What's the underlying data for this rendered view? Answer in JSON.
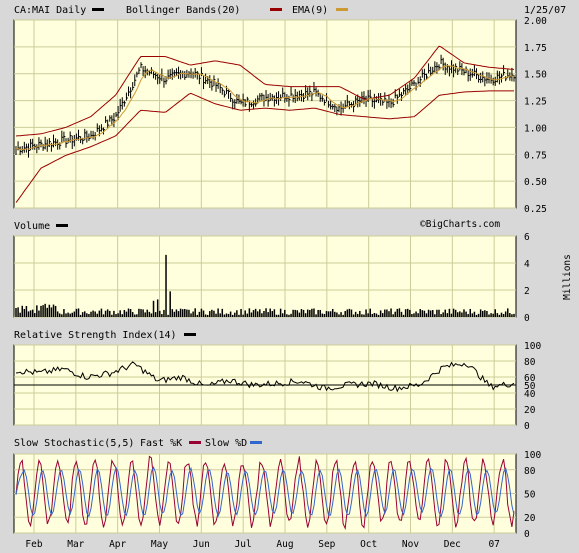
{
  "header": {
    "symbol": "CA:MAI Daily",
    "bollinger": "Bollinger Bands(20)",
    "ema": "EMA(9)",
    "date": "1/25/07"
  },
  "watermark": "©BigCharts.com",
  "colors": {
    "panel_bg": "#ffffdd",
    "grid": "#cccc99",
    "price": "#000000",
    "bollinger": "#990000",
    "ema": "#cc9933",
    "stoch_k": "#990033",
    "stoch_d": "#3366cc"
  },
  "chart_data": [
    {
      "type": "line",
      "name": "price",
      "ylim": [
        0.25,
        2.0
      ],
      "yticks": [
        "2.00",
        "1.75",
        "1.50",
        "1.25",
        "1.00",
        "0.75",
        "0.50",
        "0.25"
      ],
      "x_months": [
        "Feb",
        "Mar",
        "Apr",
        "May",
        "Jun",
        "Jul",
        "Aug",
        "Sep",
        "Oct",
        "Nov",
        "Dec",
        "07"
      ],
      "series": [
        {
          "name": "CA:MAI Daily",
          "values": [
            0.8,
            0.84,
            0.88,
            0.92,
            1.1,
            1.55,
            1.45,
            1.52,
            1.4,
            1.22,
            1.28,
            1.3,
            1.32,
            1.18,
            1.26,
            1.22,
            1.4,
            1.6,
            1.52,
            1.45,
            1.5
          ]
        },
        {
          "name": "Bollinger upper",
          "values": [
            0.92,
            0.94,
            1.0,
            1.1,
            1.3,
            1.66,
            1.66,
            1.58,
            1.62,
            1.58,
            1.4,
            1.38,
            1.38,
            1.38,
            1.26,
            1.3,
            1.46,
            1.76,
            1.6,
            1.56,
            1.54
          ]
        },
        {
          "name": "Bollinger lower",
          "values": [
            0.3,
            0.62,
            0.74,
            0.82,
            0.92,
            1.16,
            1.14,
            1.32,
            1.22,
            1.16,
            1.18,
            1.16,
            1.18,
            1.12,
            1.1,
            1.08,
            1.1,
            1.3,
            1.33,
            1.34,
            1.34
          ]
        }
      ]
    },
    {
      "type": "bar",
      "name": "Volume",
      "unit": "Millions",
      "ylim": [
        0,
        6
      ],
      "yticks": [
        "6",
        "4",
        "2",
        "0"
      ],
      "spikes": [
        4.6,
        1.9,
        1.2,
        1.3
      ]
    },
    {
      "type": "line",
      "name": "Relative Strength Index(14)",
      "ylim": [
        0,
        100
      ],
      "yticks": [
        "100",
        "80",
        "60",
        "50",
        "40",
        "20",
        "0"
      ],
      "reference": 50,
      "values": [
        68,
        65,
        70,
        60,
        65,
        76,
        55,
        60,
        48,
        56,
        50,
        52,
        55,
        46,
        50,
        52,
        46,
        50,
        72,
        78,
        48,
        52
      ]
    },
    {
      "type": "line",
      "name": "Slow Stochastic(5,5)",
      "legend": [
        "Fast %K",
        "Slow %D"
      ],
      "ylim": [
        0,
        100
      ],
      "yticks": [
        "100",
        "80",
        "50",
        "20",
        "0"
      ],
      "cycles": 27
    }
  ]
}
